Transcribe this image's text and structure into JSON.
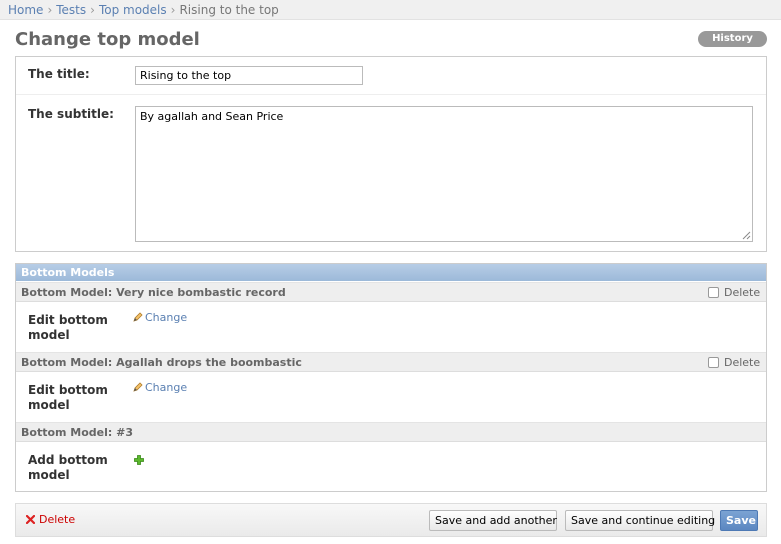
{
  "breadcrumbs": {
    "home": "Home",
    "tests": "Tests",
    "top_models": "Top models",
    "current": "Rising to the top",
    "separator": "›"
  },
  "page_title": "Change top model",
  "history_label": "History",
  "form": {
    "title_label": "The title:",
    "title_value": "Rising to the top",
    "subtitle_label": "The subtitle:",
    "subtitle_value": "By agallah and Sean Price"
  },
  "inline": {
    "header": "Bottom Models",
    "items": [
      {
        "heading": "Bottom Model: Very nice bombastic record",
        "delete_label": "Delete",
        "field_label": "Edit bottom model",
        "link_label": "Change"
      },
      {
        "heading": "Bottom Model: Agallah drops the boombastic",
        "delete_label": "Delete",
        "field_label": "Edit bottom model",
        "link_label": "Change"
      },
      {
        "heading": "Bottom Model: #3",
        "field_label": "Add bottom model"
      }
    ]
  },
  "actions": {
    "delete": "Delete",
    "save_add_another": "Save and add another",
    "save_continue": "Save and continue editing",
    "save": "Save"
  },
  "colors": {
    "link": "#5b80b2",
    "header_bar": "#9cb9d9",
    "delete": "#cc0000",
    "add_icon": "#4caf2a"
  },
  "icons": {
    "change": "pencil-icon",
    "add": "plus-icon",
    "delete": "x-icon"
  }
}
